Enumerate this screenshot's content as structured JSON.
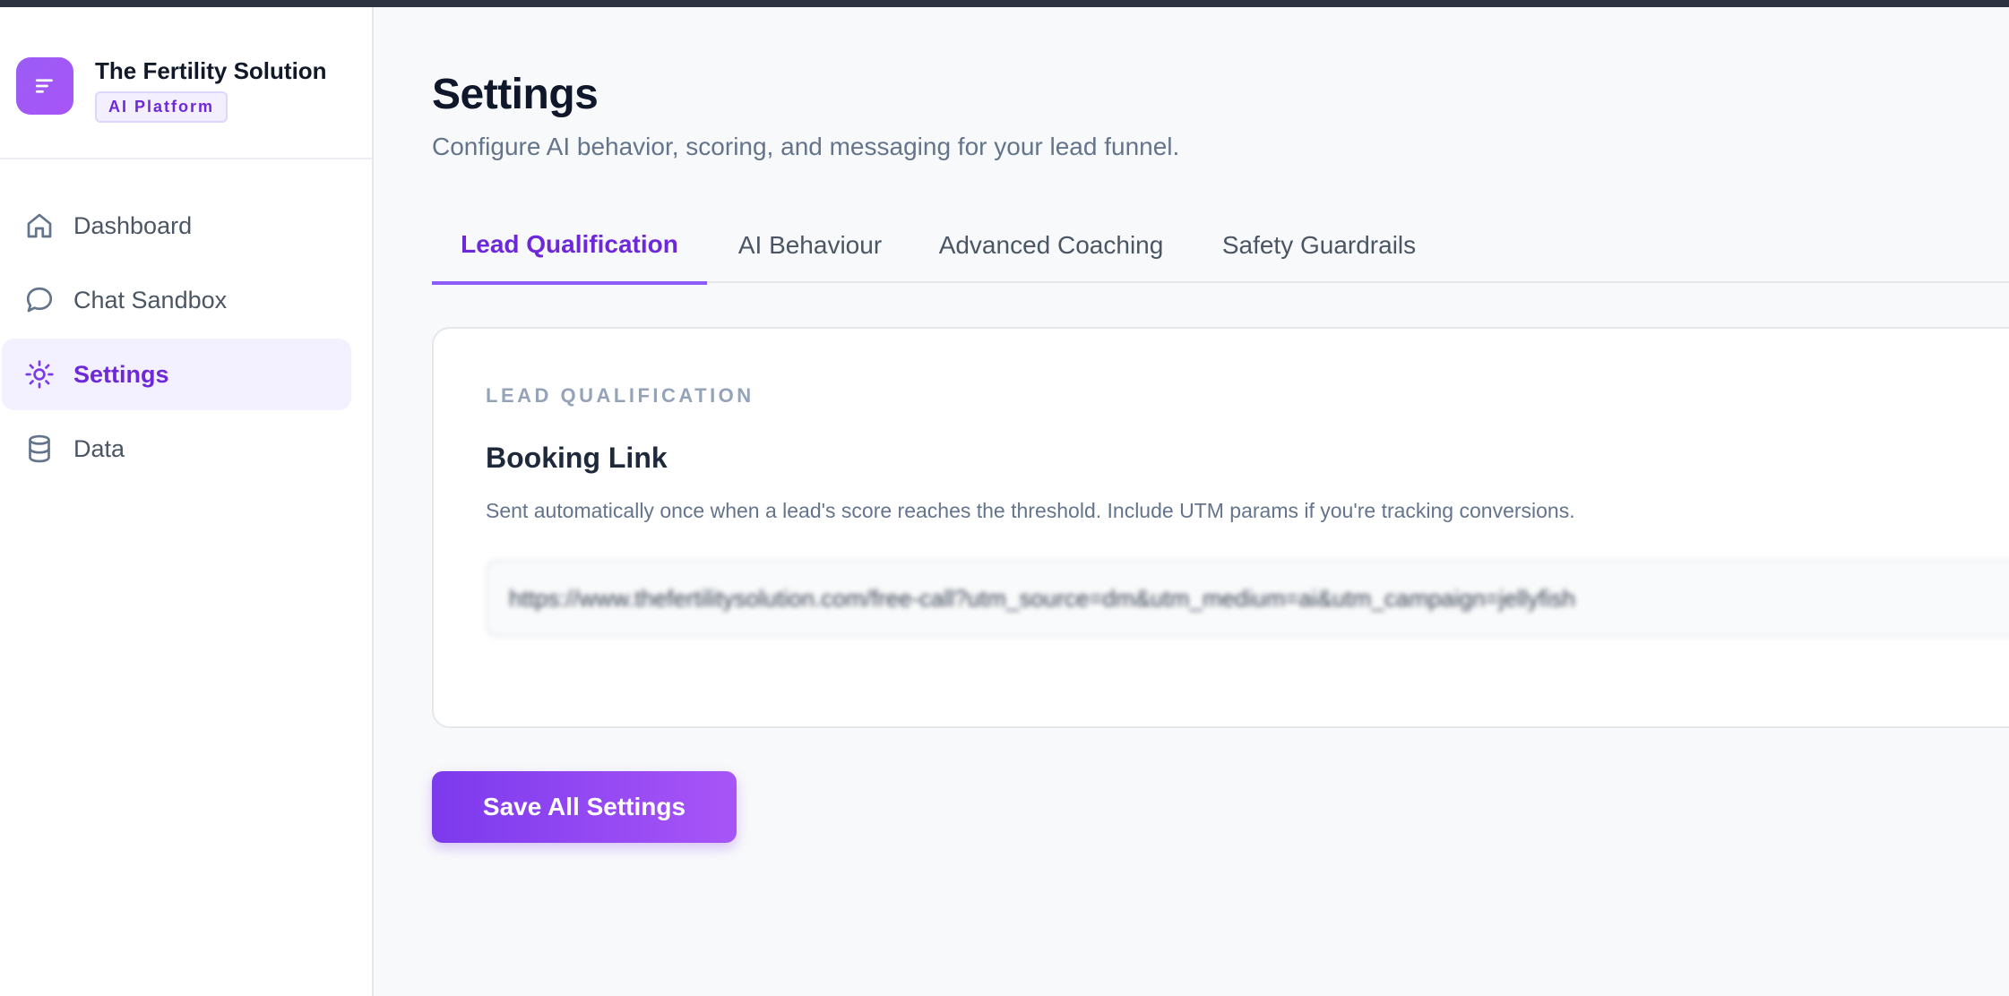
{
  "brand": {
    "name": "The Fertility Solution",
    "badge": "AI Platform",
    "logo_icon": "lines-icon"
  },
  "sidebar": {
    "items": [
      {
        "label": "Dashboard",
        "icon": "home-icon",
        "active": false
      },
      {
        "label": "Chat Sandbox",
        "icon": "chat-bubble-icon",
        "active": false
      },
      {
        "label": "Settings",
        "icon": "sun-gear-icon",
        "active": true
      },
      {
        "label": "Data",
        "icon": "database-icon",
        "active": false
      }
    ]
  },
  "header": {
    "title": "Settings",
    "subtitle": "Configure AI behavior, scoring, and messaging for your lead funnel."
  },
  "tabs": [
    {
      "label": "Lead Qualification",
      "active": true
    },
    {
      "label": "AI Behaviour",
      "active": false
    },
    {
      "label": "Advanced Coaching",
      "active": false
    },
    {
      "label": "Safety Guardrails",
      "active": false
    }
  ],
  "card": {
    "section_label": "LEAD QUALIFICATION",
    "heading": "Booking Link",
    "help": "Sent automatically once when a lead's score reaches the threshold. Include UTM params if you're tracking conversions.",
    "booking_link_value": "https://www.thefertilitysolution.com/free-call?utm_source=dm&utm_medium=ai&utm_campaign=jellyfish"
  },
  "actions": {
    "save_label": "Save All Settings"
  },
  "colors": {
    "accent": "#7c3aed",
    "accent_light": "#f3f0ff",
    "topbar": "#2d3340"
  }
}
